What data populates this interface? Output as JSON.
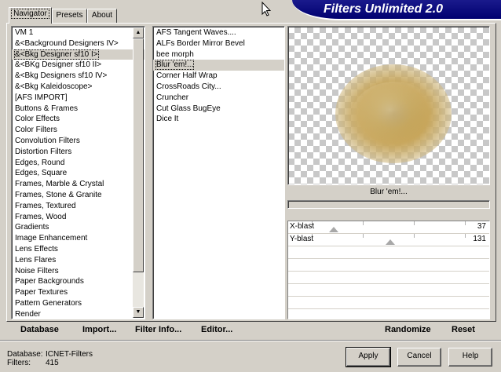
{
  "tabs": [
    {
      "label": "Navigator",
      "active": true
    },
    {
      "label": "Presets",
      "active": false
    },
    {
      "label": "About",
      "active": false
    }
  ],
  "banner": {
    "title": "Filters Unlimited 2.0"
  },
  "categories": {
    "items": [
      "VM 1",
      "&<Background Designers IV>",
      "&<Bkg Designer sf10 I>",
      "&<BKg Designer sf10 II>",
      "&<Bkg Designers sf10 IV>",
      "&<Bkg Kaleidoscope>",
      "[AFS IMPORT]",
      "Buttons & Frames",
      "Color Effects",
      "Color Filters",
      "Convolution Filters",
      "Distortion Filters",
      "Edges, Round",
      "Edges, Square",
      "Frames, Marble & Crystal",
      "Frames, Stone & Granite",
      "Frames, Textured",
      "Frames, Wood",
      "Gradients",
      "Image Enhancement",
      "Lens Effects",
      "Lens Flares",
      "Noise Filters",
      "Paper Backgrounds",
      "Paper Textures",
      "Pattern Generators",
      "Render"
    ],
    "selected_index": 2
  },
  "filters": {
    "items": [
      "AFS Tangent Waves....",
      "ALFs Border Mirror Bevel",
      "bee morph",
      "Blur 'em!...",
      "Corner Half Wrap",
      "CrossRoads City...",
      "Cruncher",
      "Cut Glass  BugEye",
      "Dice It"
    ],
    "selected_index": 3
  },
  "preview": {
    "filter_name": "Blur 'em!..."
  },
  "sliders": [
    {
      "label": "X-blast",
      "value": "37",
      "fraction": 0.145
    },
    {
      "label": "Y-blast",
      "value": "131",
      "fraction": 0.514
    }
  ],
  "toolbar": {
    "database": "Database",
    "import": "Import...",
    "filter_info": "Filter Info...",
    "editor": "Editor...",
    "randomize": "Randomize",
    "reset": "Reset"
  },
  "status": {
    "database_label": "Database:",
    "database_value": "ICNET-Filters",
    "filters_label": "Filters:",
    "filters_value": "415"
  },
  "buttons": {
    "apply": "Apply",
    "cancel": "Cancel",
    "help": "Help"
  },
  "scrollbar": {
    "up": "▲",
    "down": "▼"
  }
}
